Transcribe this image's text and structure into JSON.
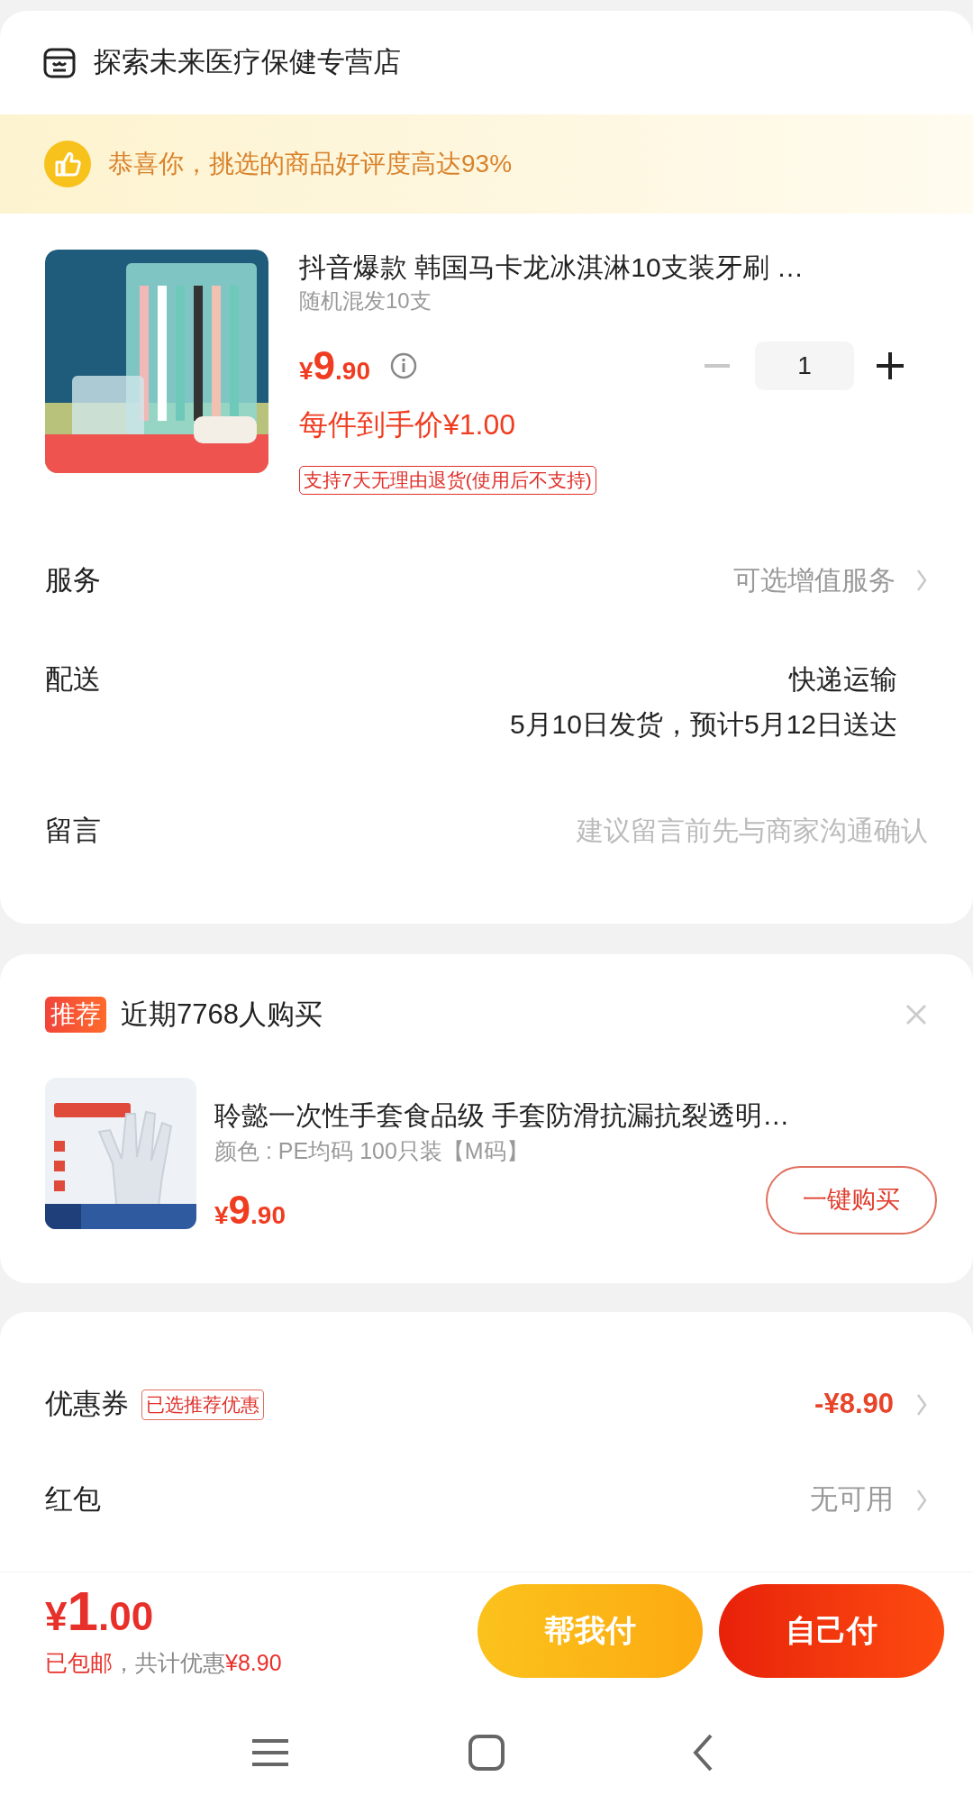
{
  "store": {
    "name": "探索未来医疗保健专营店"
  },
  "banner": {
    "text": "恭喜你，挑选的商品好评度高达93%"
  },
  "product": {
    "title": "抖音爆款 韩国马卡龙冰淇淋10支装牙刷 …",
    "spec": "随机混发10支",
    "price": "¥9.90",
    "final_price": "每件到手价¥1.00",
    "quantity": "1",
    "decrease_disabled": true,
    "return_tag": "支持7天无理由退货(使用后不支持)"
  },
  "rows": [
    {
      "label": "服务",
      "value": "可选增值服务",
      "kind": "link"
    },
    {
      "label": "配送",
      "value": "快递运输",
      "detail": "5月10日发货，预计5月12日送达",
      "kind": "delivery"
    },
    {
      "label": "留言",
      "placeholder": "建议留言前先与商家沟通确认",
      "kind": "input"
    }
  ],
  "recommend": {
    "badge": "推荐",
    "title": "近期7768人购买",
    "product_title": "聆懿一次性手套食品级 手套防滑抗漏抗裂透明…",
    "spec": "颜色 : PE均码 100只装【M码】",
    "price": "¥9.90",
    "button": "一键购买"
  },
  "discounts": [
    {
      "label": "优惠券",
      "tag": "已选推荐优惠",
      "value": "-¥8.90",
      "highlight": true
    },
    {
      "label": "红包",
      "value": "无可用",
      "highlight": false
    }
  ],
  "footer": {
    "total": "¥1.00",
    "shipping": "已包邮",
    "saving_label": "，共计优惠",
    "saving": "¥8.90",
    "buttons": [
      {
        "label": "帮我付",
        "kind": "secondary"
      },
      {
        "label": "自己付",
        "kind": "primary"
      }
    ]
  }
}
